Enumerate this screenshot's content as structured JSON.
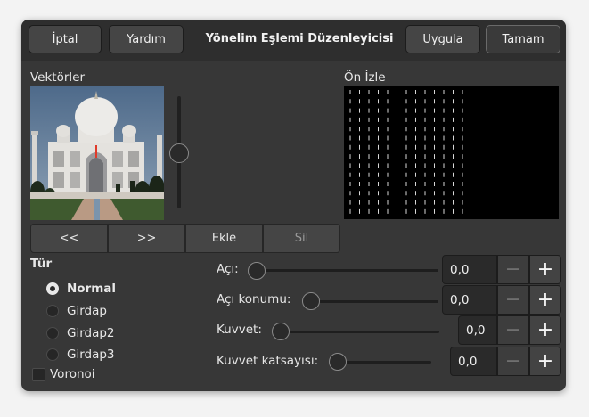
{
  "header": {
    "title": "Yönelim Eşlemi Düzenleyicisi",
    "cancel_label": "İptal",
    "help_label": "Yardım",
    "apply_label": "Uygula",
    "ok_label": "Tamam"
  },
  "vectors": {
    "label": "Vektörler",
    "prev_label": "<<",
    "next_label": ">>",
    "add_label": "Ekle",
    "delete_label": "Sil"
  },
  "preview": {
    "label": "Ön İzle"
  },
  "type": {
    "label": "Tür",
    "options": [
      "Normal",
      "Girdap",
      "Girdap2",
      "Girdap3"
    ],
    "selected": "Normal"
  },
  "voronoi": {
    "label": "Voronoi",
    "checked": false
  },
  "sliders": [
    {
      "label": "Açı:",
      "value": "0,0"
    },
    {
      "label": "Açı konumu:",
      "value": "0,0"
    },
    {
      "label": "Kuvvet:",
      "value": "0,0"
    },
    {
      "label": "Kuvvet katsayısı:",
      "value": "0,0"
    }
  ],
  "icons": {
    "minus": "−",
    "plus": "+"
  },
  "colors": {
    "window": "#373737",
    "headerbar": "#2e2e2e",
    "preview": "#000000"
  }
}
